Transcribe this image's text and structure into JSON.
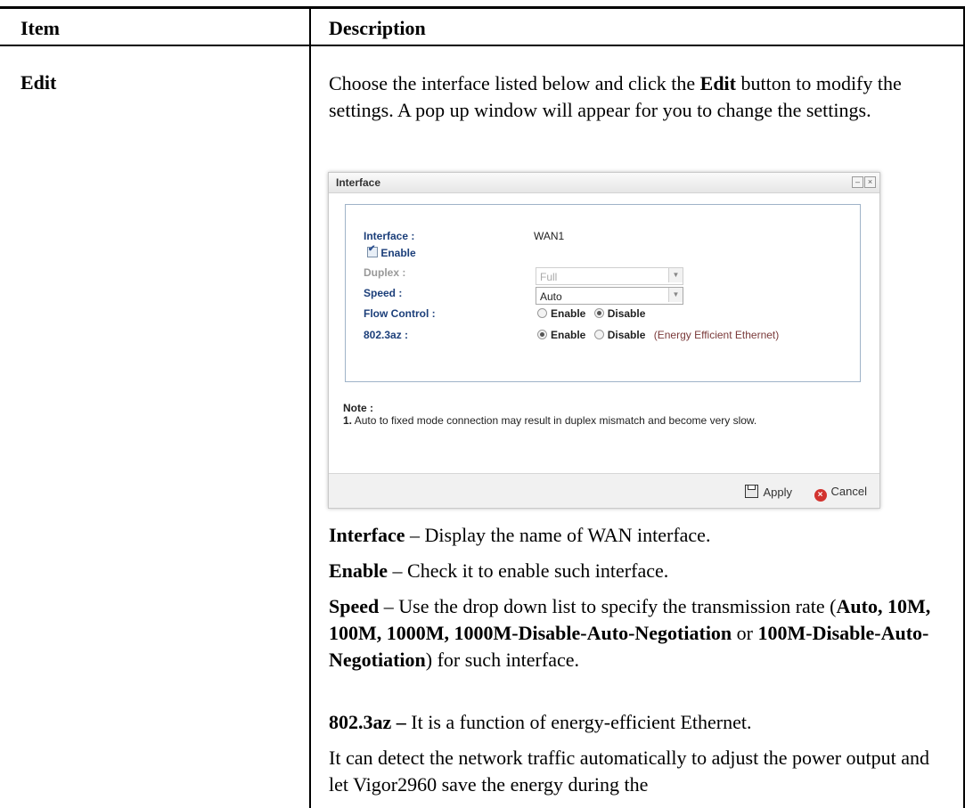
{
  "table": {
    "header_item": "Item",
    "header_description": "Description",
    "row_item": "Edit"
  },
  "intro": {
    "p1_a": "Choose the interface listed below and click the ",
    "p1_b": "Edit",
    "p1_c": " button to modify the settings. A pop up window will appear for you to change the settings."
  },
  "dialog": {
    "title": "Interface",
    "ghost_headers": [
      "Enable",
      "Duplex",
      "Speed"
    ],
    "interface_label": "Interface :",
    "interface_value": "WAN1",
    "enable_label": "Enable",
    "enable_checked": true,
    "duplex_label": "Duplex",
    "duplex_value": "Full",
    "speed_label": "Speed",
    "speed_value": "Auto",
    "flow_control_label": "Flow Control",
    "flow_enable": "Enable",
    "flow_disable": "Disable",
    "flow_selected": "Disable",
    "az_label": "802.3az",
    "az_enable": "Enable",
    "az_disable": "Disable",
    "az_selected": "Enable",
    "az_note": "(Energy Efficient Ethernet)",
    "note_title": "Note :",
    "note_1_num": "1.",
    "note_1_text": "Auto to fixed mode connection may result in duplex mismatch and become very slow.",
    "apply_label": "Apply",
    "cancel_label": "Cancel"
  },
  "descriptions": {
    "interface_term": "Interface",
    "interface_text": " – Display the name of WAN interface.",
    "enable_term": "Enable",
    "enable_text": " – Check it to enable such interface.",
    "speed_term": "Speed",
    "speed_text_1": " – Use the drop down list to specify the transmission rate (",
    "speed_options": "Auto, 10M, 100M, 1000M, 1000M-Disable-Auto-Negotiation",
    "speed_or": " or ",
    "speed_option_last": "100M-Disable-Auto-Negotiation",
    "speed_text_2": ") for such interface.",
    "az_term": "802.3az –",
    "az_text": " It is a function of energy-efficient Ethernet.",
    "detect_text": "It can detect the network traffic automatically to adjust the power output and let Vigor2960 save the energy during the"
  }
}
